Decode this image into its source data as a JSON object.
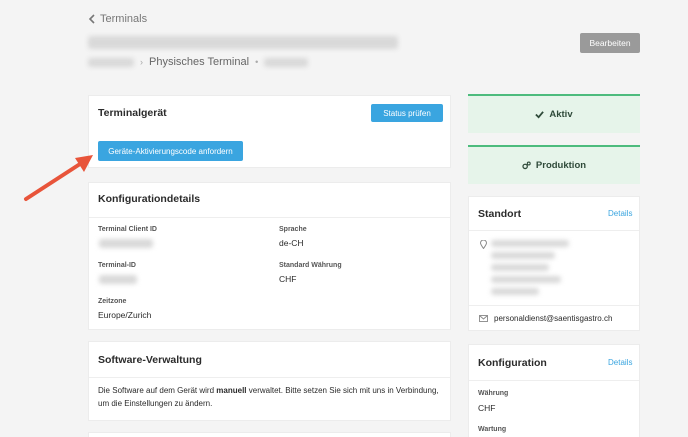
{
  "header": {
    "back_label": "Terminals",
    "breadcrumb_type": "Physisches Terminal",
    "edit_label": "Bearbeiten"
  },
  "terminal_device": {
    "title": "Terminalgerät",
    "status_check_label": "Status prüfen",
    "request_code_label": "Geräte-Aktivierungscode anfordern"
  },
  "config_details": {
    "title": "Konfigurationdetails",
    "client_id_label": "Terminal Client ID",
    "terminal_id_label": "Terminal-ID",
    "language_label": "Sprache",
    "language_value": "de-CH",
    "currency_label": "Standard Währung",
    "currency_value": "CHF",
    "timezone_label": "Zeitzone",
    "timezone_value": "Europe/Zurich"
  },
  "software": {
    "title": "Software-Verwaltung",
    "text_before": "Die Software auf dem Gerät wird ",
    "text_bold": "manuell",
    "text_after": " verwaltet. Bitte setzen Sie sich mit uns in Verbindung, um die Einstellungen zu ändern."
  },
  "status_active": {
    "label": "Aktiv",
    "icon": "check-icon"
  },
  "status_production": {
    "label": "Produktion",
    "icon": "gears-icon"
  },
  "location": {
    "title": "Standort",
    "details_label": "Details",
    "email": "personaldienst@saentisgastro.ch"
  },
  "configuration": {
    "title": "Konfiguration",
    "details_label": "Details",
    "currency_label": "Währung",
    "currency_value": "CHF",
    "maintenance_label": "Wartung"
  },
  "colors": {
    "accent": "#3aa5e0",
    "active_green": "#4dbb7d",
    "status_bg": "#e6f4ea",
    "arrow": "#e8543a"
  }
}
